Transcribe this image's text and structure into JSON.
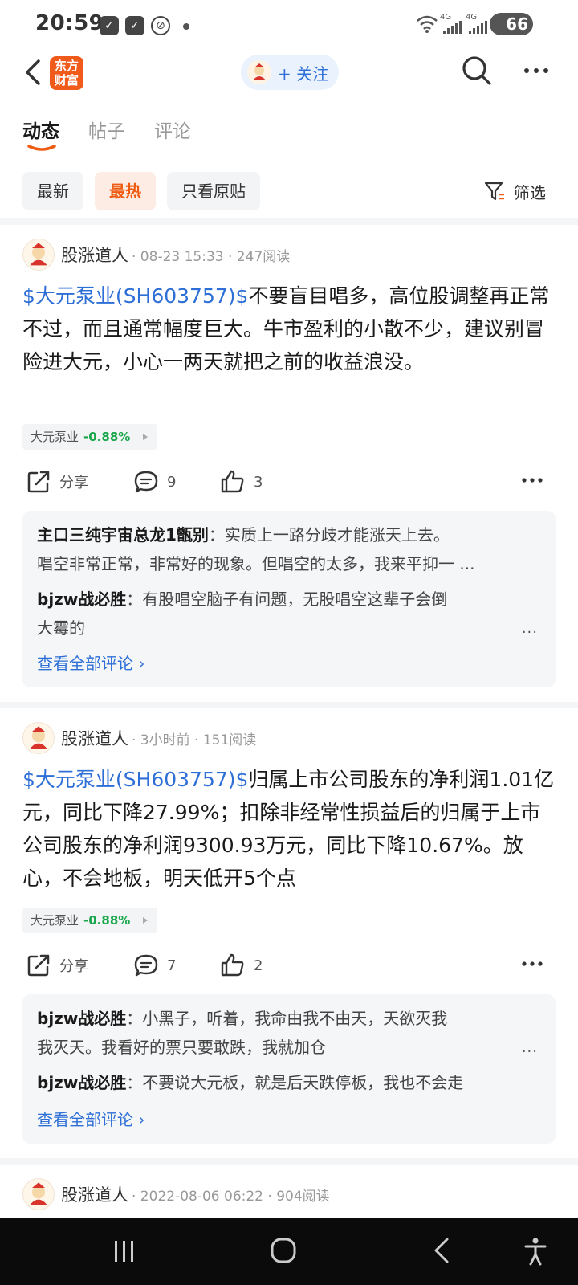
{
  "status_bar": {
    "time": "20:59",
    "network_1": "4G",
    "network_2": "4G",
    "battery": "66"
  },
  "header": {
    "app_logo_line1": "东方",
    "app_logo_line2": "财富",
    "follow_label": "+ 关注"
  },
  "tabs": [
    {
      "label": "动态",
      "active": true
    },
    {
      "label": "帖子",
      "active": false
    },
    {
      "label": "评论",
      "active": false
    }
  ],
  "filters": {
    "chips": [
      "最新",
      "最热",
      "只看原贴"
    ],
    "selected": "最热",
    "filter_label": "筛选"
  },
  "posts": [
    {
      "author": "股涨道人",
      "meta": "· 08-23 15:33 · 247阅读",
      "tag": "$大元泵业(SH603757)$",
      "text": "不要盲目唱多，高位股调整再正常不过，而且通常幅度巨大。牛市盈利的小散不少，建议别冒险进大元，小心一两天就把之前的收益浪没。",
      "stock_name": "大元泵业",
      "stock_change": "-0.88%",
      "share_label": "分享",
      "comment_count": "9",
      "like_count": "3",
      "comments": [
        {
          "user": "主口三纯宇宙总龙1甑别",
          "sep": "：",
          "line1": "实质上一路分歧才能涨天上去。",
          "line2": "唱空非常正常，非常好的现象。但唱空的太多，我来平抑一 ..."
        },
        {
          "user": "bjzw战必胜",
          "sep": "：",
          "line1": "有股唱空脑子有问题，无股唱空这辈子会倒",
          "line2": "大霉的"
        }
      ],
      "view_all": "查看全部评论 ›"
    },
    {
      "author": "股涨道人",
      "meta": "· 3小时前 · 151阅读",
      "tag": "$大元泵业(SH603757)$",
      "text": "归属上市公司股东的净利润1.01亿元，同比下降27.99%；扣除非经常性损益后的归属于上市公司股东的净利润9300.93万元，同比下降10.67%。放心，不会地板，明天低开5个点",
      "stock_name": "大元泵业",
      "stock_change": "-0.88%",
      "share_label": "分享",
      "comment_count": "7",
      "like_count": "2",
      "comments": [
        {
          "user": "bjzw战必胜",
          "sep": "：",
          "line1": "小黑子，听着，我命由我不由天，天欲灭我",
          "line2": "我灭天。我看好的票只要敢跌，我就加仓"
        },
        {
          "user": "bjzw战必胜",
          "sep": "：",
          "line1": "不要说大元板，就是后天跌停板，我也不会走",
          "line2": ""
        }
      ],
      "view_all": "查看全部评论 ›"
    },
    {
      "author": "股涨道人",
      "meta": "· 2022-08-06 06:22 · 904阅读"
    }
  ],
  "ellipsis": "...",
  "colors": {
    "accent_blue": "#2d6fd6",
    "accent_orange": "#ee5a0f",
    "down_green": "#1aa64b",
    "logo_orange": "#f05a1a"
  },
  "icons": [
    "back-icon",
    "search-icon",
    "more-icon",
    "filter-icon",
    "share-icon",
    "comment-icon",
    "like-icon",
    "nav-recents-icon",
    "nav-home-icon",
    "nav-back-icon",
    "accessibility-icon"
  ]
}
